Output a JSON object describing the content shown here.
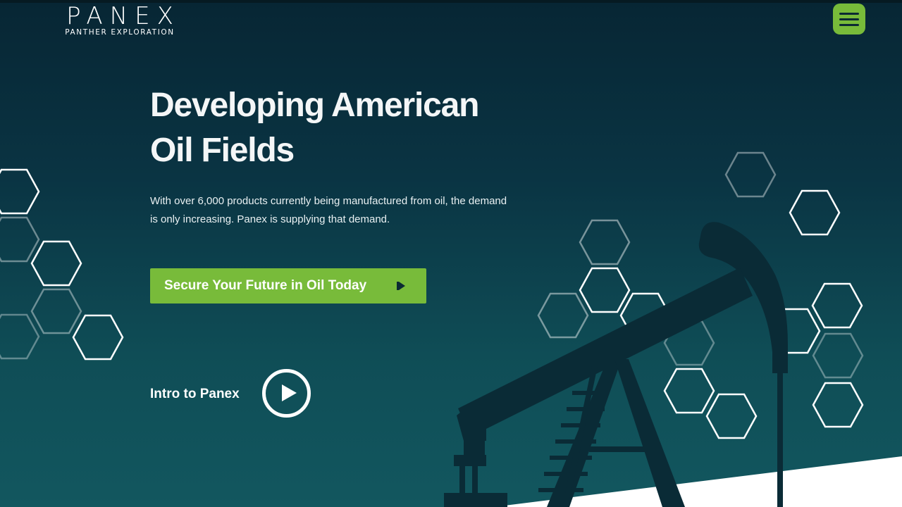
{
  "logo": {
    "wordmark": "PANEX",
    "tagline": "PANTHER EXPLORATION"
  },
  "nav": {
    "menu_icon": "hamburger-menu-icon"
  },
  "hero": {
    "headline_line1": "Developing American",
    "headline_line2": "Oil Fields",
    "subtext": "With over 6,000 products currently being manufactured from oil, the demand is only increasing. Panex is supplying that demand.",
    "cta_label": "Secure Your Future in Oil Today",
    "cta_icon": "play-arrow-icon",
    "intro_label": "Intro to Panex",
    "intro_icon": "play-circle-icon"
  },
  "colors": {
    "accent_green": "#78bb3a",
    "background_dark": "#072634",
    "background_teal": "#12575f",
    "silhouette": "#0a2b36",
    "hexagon_outline": "#ffffff"
  }
}
